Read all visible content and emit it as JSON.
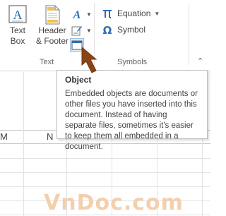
{
  "ribbon": {
    "text_box_label_line1": "Text",
    "text_box_label_line2": "Box",
    "header_footer_label_line1": "Header",
    "header_footer_label_line2": "& Footer",
    "text_group_label": "Text",
    "equation_label": "Equation",
    "symbol_label": "Symbol",
    "symbols_group_label": "Symbols"
  },
  "tooltip": {
    "title": "Object",
    "body": "Embedded objects are documents or other files you have inserted into this document. Instead of having separate files, sometimes it's easier to keep them all embedded in a document."
  },
  "sheet": {
    "col_letters": [
      "M",
      "N"
    ]
  },
  "watermark": "VnDoc.com",
  "colors": {
    "accent_blue": "#2b6fb5",
    "cursor_brown": "#8a4516",
    "watermark": "#f3cfae"
  },
  "icons": {
    "text_box": "text-box-icon",
    "header_footer": "header-footer-icon",
    "wordart": "wordart-icon",
    "signature": "signature-line-icon",
    "object": "object-icon",
    "equation": "pi-icon",
    "symbol": "omega-icon"
  }
}
